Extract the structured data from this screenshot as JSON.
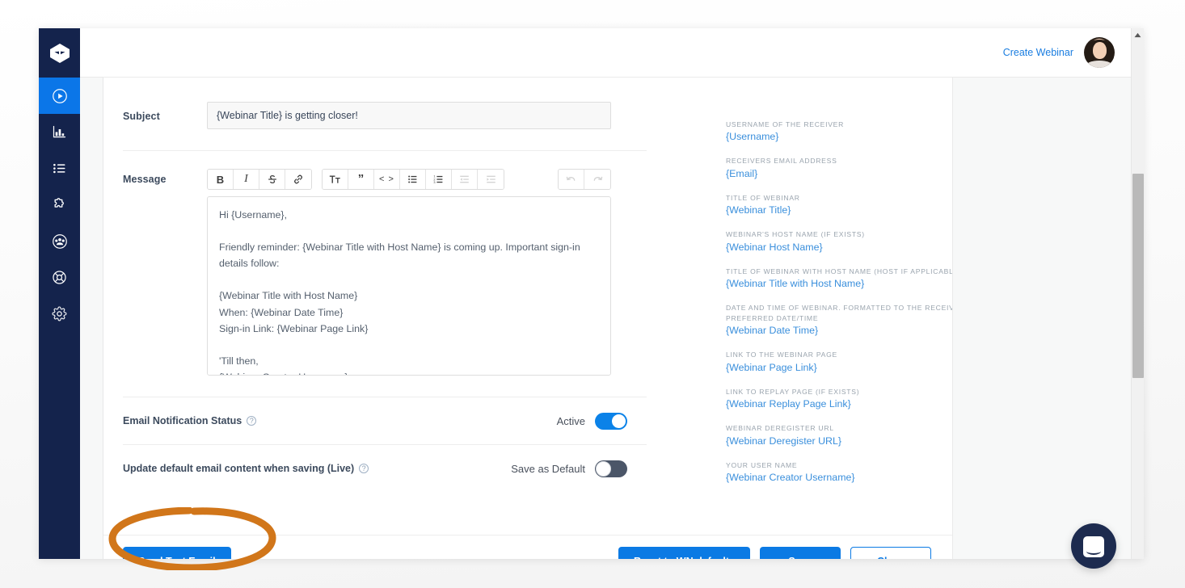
{
  "header": {
    "create_webinar_label": "Create Webinar",
    "avatar_name": "user-avatar"
  },
  "sidebar": {
    "logo_name": "app-logo",
    "items": [
      {
        "id": "webinars",
        "icon": "play-circle-icon",
        "active": true
      },
      {
        "id": "analytics",
        "icon": "bar-chart-icon",
        "active": false
      },
      {
        "id": "list",
        "icon": "list-icon",
        "active": false
      },
      {
        "id": "integrations",
        "icon": "puzzle-icon",
        "active": false
      },
      {
        "id": "contacts",
        "icon": "people-icon",
        "active": false
      },
      {
        "id": "support",
        "icon": "lifebuoy-icon",
        "active": false
      },
      {
        "id": "settings",
        "icon": "gear-icon",
        "active": false
      }
    ]
  },
  "form": {
    "subject_label": "Subject",
    "subject_value": "{Webinar Title} is getting closer!",
    "subject_placeholder": "Subject",
    "message_label": "Message",
    "message_value": "Hi {Username},\n\nFriendly reminder: {Webinar Title with Host Name} is coming up. Important sign-in details follow:\n\n{Webinar Title with Host Name}\nWhen: {Webinar Date Time}\nSign-in Link: {Webinar Page Link}\n\n'Till then,\n{Webinar Creator Username}"
  },
  "toolbar": {
    "groups": [
      [
        {
          "name": "bold-icon",
          "glyph": "B",
          "style": "bold",
          "disabled": false
        },
        {
          "name": "italic-icon",
          "glyph": "I",
          "style": "italic",
          "disabled": false
        },
        {
          "name": "strikethrough-icon",
          "glyph": "S",
          "style": "strike",
          "disabled": false
        },
        {
          "name": "link-icon",
          "glyph": "\u0000",
          "style": "link",
          "disabled": false
        }
      ],
      [
        {
          "name": "heading-icon",
          "glyph": "T",
          "style": "heading",
          "disabled": false
        },
        {
          "name": "blockquote-icon",
          "glyph": "”",
          "style": "quote",
          "disabled": false
        },
        {
          "name": "code-icon",
          "glyph": "<>",
          "style": "code",
          "disabled": false
        },
        {
          "name": "bulleted-list-icon",
          "glyph": "ul",
          "style": "ul",
          "disabled": false
        },
        {
          "name": "numbered-list-icon",
          "glyph": "ol",
          "style": "ol",
          "disabled": false
        },
        {
          "name": "outdent-icon",
          "glyph": "out",
          "style": "outdent",
          "disabled": true
        },
        {
          "name": "indent-icon",
          "glyph": "in",
          "style": "indent",
          "disabled": true
        }
      ],
      [
        {
          "name": "undo-icon",
          "glyph": "undo",
          "style": "undo",
          "disabled": true
        },
        {
          "name": "redo-icon",
          "glyph": "redo",
          "style": "redo",
          "disabled": true
        }
      ]
    ]
  },
  "settings": [
    {
      "label": "Email Notification Status",
      "help": "?",
      "state_text": "Active",
      "toggle_on": true
    },
    {
      "label": "Update default email content when saving (Live)",
      "help": "?",
      "state_text": "Save as Default",
      "toggle_on": false
    }
  ],
  "variables": [
    {
      "title": "USERNAME OF THE RECEIVER",
      "token": "{Username}"
    },
    {
      "title": "RECEIVERS EMAIL ADDRESS",
      "token": "{Email}"
    },
    {
      "title": "TITLE OF WEBINAR",
      "token": "{Webinar Title}"
    },
    {
      "title": "WEBINAR'S HOST NAME (IF EXISTS)",
      "token": "{Webinar Host Name}"
    },
    {
      "title": "TITLE OF WEBINAR WITH HOST NAME (HOST IF APPLICABLE)",
      "token": "{Webinar Title with Host Name}"
    },
    {
      "title": "DATE AND TIME OF WEBINAR. FORMATTED TO THE RECEIVERS PREFERRED DATE/TIME",
      "token": "{Webinar Date Time}"
    },
    {
      "title": "LINK TO THE WEBINAR PAGE",
      "token": "{Webinar Page Link}"
    },
    {
      "title": "LINK TO REPLAY PAGE (IF EXISTS)",
      "token": "{Webinar Replay Page Link}"
    },
    {
      "title": "WEBINAR DEREGISTER URL",
      "token": "{Webinar Deregister URL}"
    },
    {
      "title": "YOUR USER NAME",
      "token": "{Webinar Creator Username}"
    }
  ],
  "footer": {
    "send_test_email": "Send Test Email",
    "reset_defaults": "Reset to WN defaults",
    "save": "Save",
    "close": "Close"
  },
  "annotation": {
    "shape": "ellipse",
    "color": "#D1761A",
    "targets": "Send Test Email"
  },
  "colors": {
    "accent_blue": "#0b7ae4",
    "sidebar_navy": "#14234c",
    "active_nav": "#0b76e8",
    "link_blue": "#3a8fdc",
    "annotation_orange": "#D1761A",
    "toggle_off_track": "#4b5668"
  },
  "chat": {
    "widget_name": "intercom-chat-launcher"
  }
}
